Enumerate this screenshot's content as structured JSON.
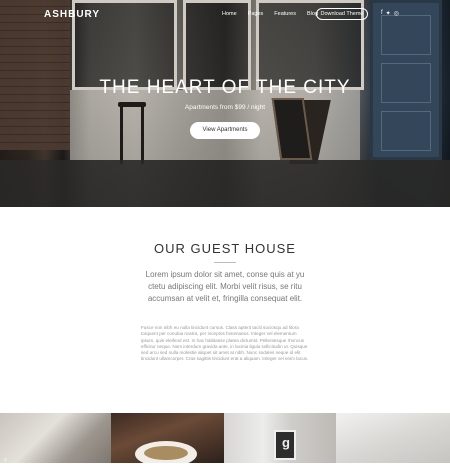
{
  "nav": {
    "logo": "ASHBURY",
    "items": [
      "Home",
      "Pages",
      "Features",
      "Blog"
    ],
    "cta": "Download Theme",
    "social": [
      "facebook-icon",
      "twitter-icon",
      "instagram-icon"
    ]
  },
  "hero": {
    "title": "THE HEART OF THE CITY",
    "subtitle": "Apartments from $99 / night",
    "button": "View Apartments"
  },
  "guest": {
    "title": "OUR GUEST HOUSE",
    "lead": "Lorem ipsum dolor sit amet, conse quis at yu ctetu adipiscing elit. Morbi velit risus, se ritu accumsan at velit et, fringilla consequat elit.",
    "body": "Fusce non nibh eu nulla tincidunt cursus. Class aptent taciti sociosqu ad litora torquent per conubia nostra, per inceptos himenaeos. Integer vel elementum ipsum, quis eleifend est. In hac habitasse platea dictumst. Pellentesque rhoncus efficitur neque. Nam interdum gravida ante, in lacinia ligula sollicitudin ut. Quisque sed arcu sed nulla molestie aliquet sit amet at nibh. Nunc sodales neque id elit tincidunt ullamcorper. Cras sagittis tincidunt erat a aliquam. Integer vel enim lacus."
  },
  "colors": {
    "accent": "#ffffff",
    "text": "#333333",
    "muted": "#777777"
  }
}
